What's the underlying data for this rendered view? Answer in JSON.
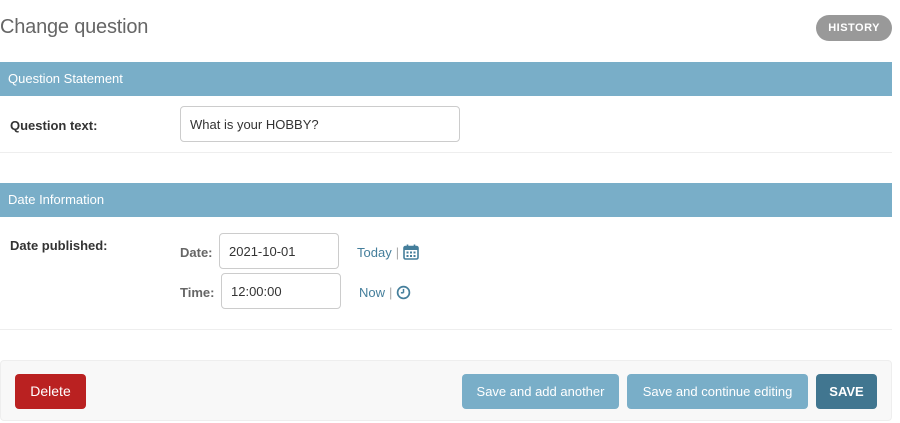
{
  "header": {
    "title": "Change question",
    "history_label": "HISTORY"
  },
  "fieldsets": {
    "question": {
      "title": "Question Statement",
      "field_label": "Question text:",
      "field_value": "What is your HOBBY?"
    },
    "date": {
      "title": "Date Information",
      "field_label": "Date published:",
      "date_label": "Date:",
      "date_value": "2021-10-01",
      "today_label": "Today",
      "time_label": "Time:",
      "time_value": "12:00:00",
      "now_label": "Now",
      "separator": "|"
    }
  },
  "actions": {
    "delete_label": "Delete",
    "save_add_label": "Save and add another",
    "save_continue_label": "Save and continue editing",
    "save_label": "SAVE"
  },
  "colors": {
    "header_bar": "#79aec8",
    "link": "#447e9b",
    "delete": "#ba2121",
    "save": "#417690"
  }
}
